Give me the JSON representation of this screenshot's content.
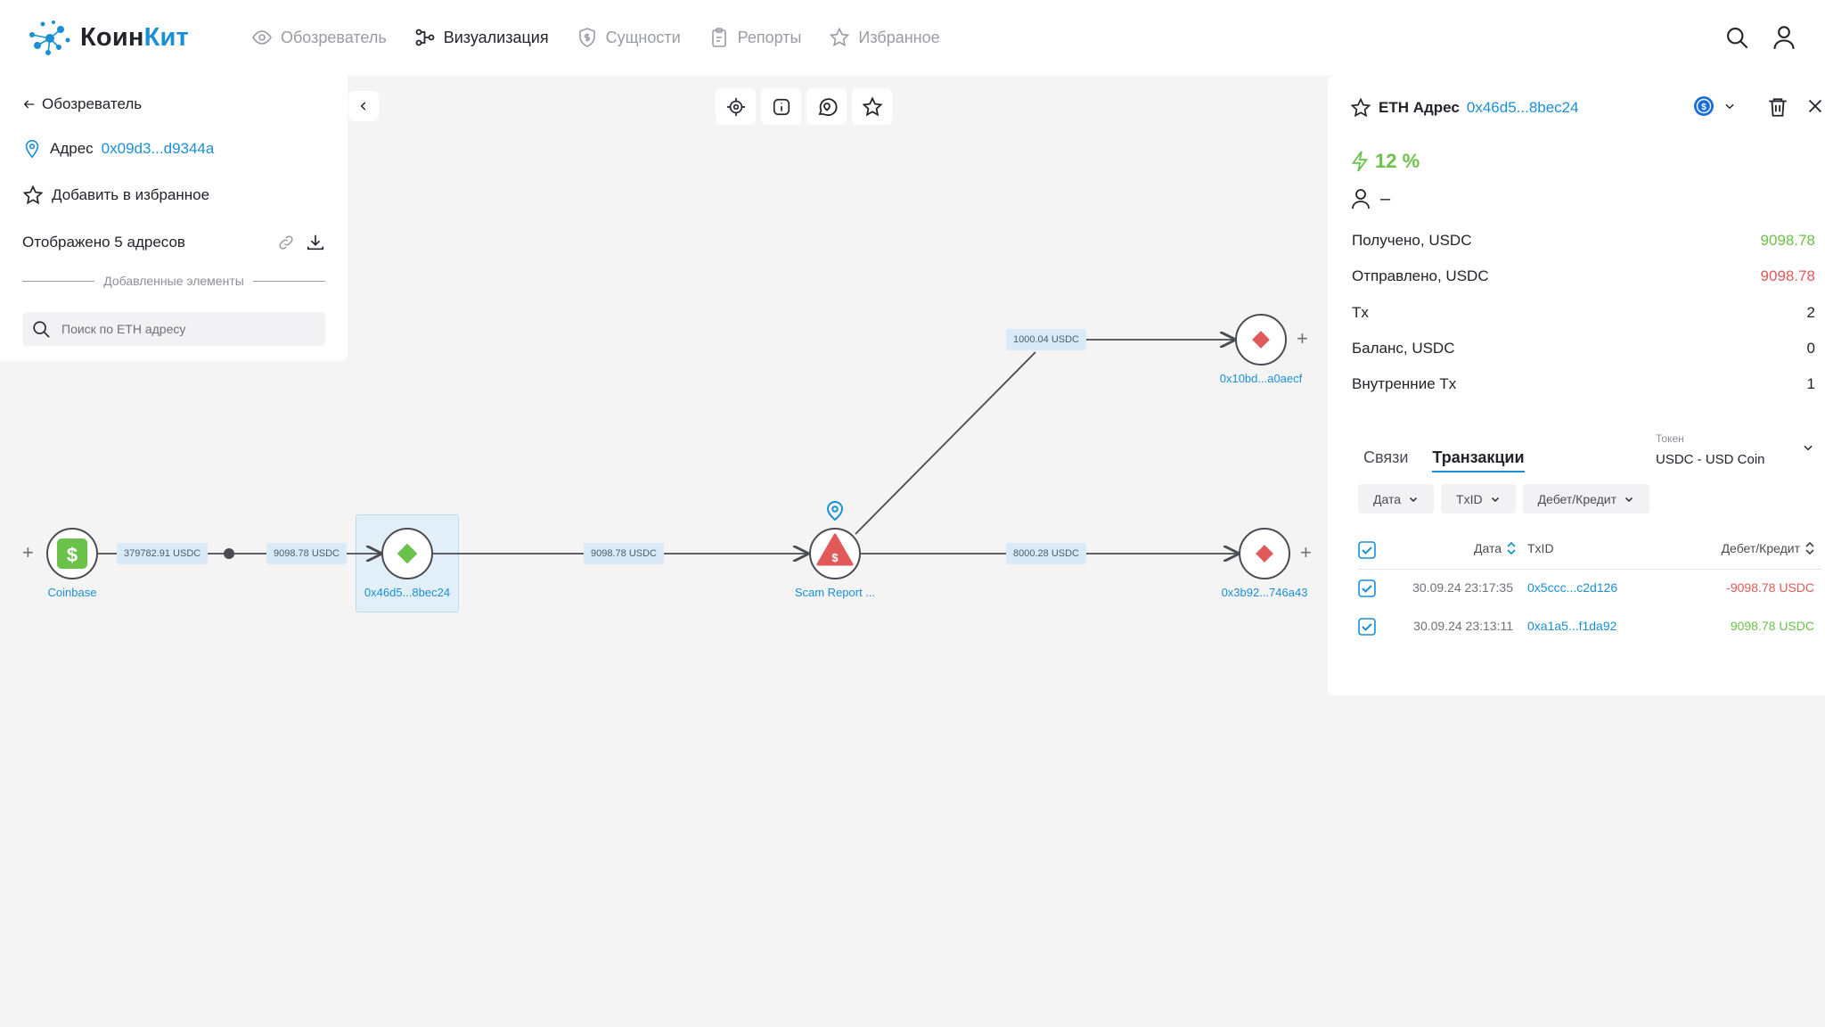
{
  "app": {
    "logo_part1": "Коин",
    "logo_part2": "Кит"
  },
  "nav": [
    {
      "label": "Обозреватель",
      "icon": "eye-icon",
      "active": false
    },
    {
      "label": "Визуализация",
      "icon": "graph-icon",
      "active": true
    },
    {
      "label": "Сущности",
      "icon": "shield-dollar-icon",
      "active": false
    },
    {
      "label": "Репорты",
      "icon": "clipboard-icon",
      "active": false
    },
    {
      "label": "Избранное",
      "icon": "star-icon",
      "active": false
    }
  ],
  "left_panel": {
    "back_label": "Обозреватель",
    "address_prefix": "Адрес",
    "address_value": "0x09d3...d9344a",
    "favorite_label": "Добавить в избранное",
    "shown_label": "Отображено 5 адресов",
    "divider_label": "Добавленные элементы",
    "search_placeholder": "Поиск по ETH адресу"
  },
  "graph": {
    "nodes": {
      "coinbase": "Coinbase",
      "selected": "0x46d5...8bec24",
      "scam": "Scam Report ...",
      "top": "0x10bd...a0aecf",
      "right": "0x3b92...746a43"
    },
    "edges": {
      "e1": "379782.91 USDC",
      "e2": "9098.78 USDC",
      "e3": "9098.78 USDC",
      "e4": "1000.04 USDC",
      "e5": "8000.28 USDC"
    },
    "plus": "+"
  },
  "right_panel": {
    "title_prefix": "ETH Адрес",
    "title_addr": "0x46d5...8bec24",
    "score": "12 %",
    "owner": "–",
    "stats": [
      {
        "label": "Получено, USDC",
        "value": "9098.78",
        "tone": "green"
      },
      {
        "label": "Отправлено, USDC",
        "value": "9098.78",
        "tone": "red"
      },
      {
        "label": "Tx",
        "value": "2",
        "tone": ""
      },
      {
        "label": "Баланс, USDC",
        "value": "0",
        "tone": ""
      },
      {
        "label": "Внутренние Tx",
        "value": "1",
        "tone": ""
      }
    ],
    "tabs": [
      "Связи",
      "Транзакции"
    ],
    "token_label": "Токен",
    "token_value": "USDC - USD Coin",
    "filters": [
      "Дата",
      "TxID",
      "Дебет/Кредит"
    ],
    "table": {
      "headers": {
        "date": "Дата",
        "txid": "TxID",
        "amount": "Дебет/Кредит"
      },
      "rows": [
        {
          "date": "30.09.24 23:17:35",
          "txid": "0x5ccc...c2d126",
          "amount": "-9098.78 USDC",
          "tone": "neg"
        },
        {
          "date": "30.09.24 23:13:11",
          "txid": "0xa1a5...f1da92",
          "amount": "9098.78 USDC",
          "tone": "pos"
        }
      ]
    }
  },
  "colors": {
    "accent": "#1a8fd6",
    "green": "#6bc24a",
    "red": "#e05a5a"
  }
}
